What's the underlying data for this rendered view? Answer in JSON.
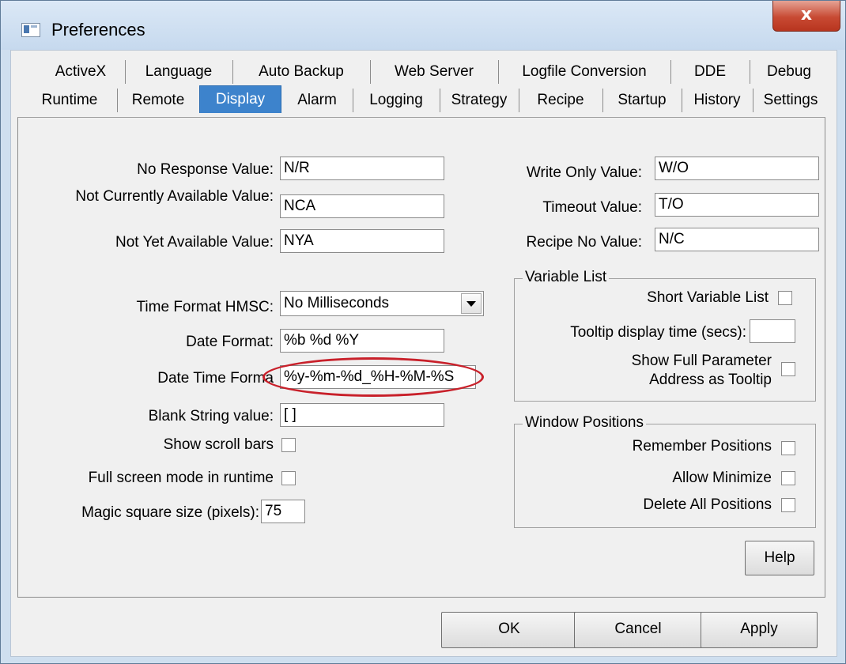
{
  "window": {
    "title": "Preferences",
    "close_glyph": "x"
  },
  "tabs": {
    "row1": [
      "ActiveX",
      "Language",
      "Auto Backup",
      "Web Server",
      "Logfile Conversion",
      "DDE",
      "Debug"
    ],
    "row2": [
      "Runtime",
      "Remote",
      "Display",
      "Alarm",
      "Logging",
      "Strategy",
      "Recipe",
      "Startup",
      "History",
      "Settings"
    ],
    "active": "Display"
  },
  "left": {
    "no_response_label": "No Response Value:",
    "no_response_value": "N/R",
    "not_currently_label": "Not Currently Available Value:",
    "not_currently_value": "NCA",
    "not_yet_label": "Not Yet Available Value:",
    "not_yet_value": "NYA",
    "time_format_label": "Time Format HMSC:",
    "time_format_value": "No Milliseconds",
    "date_format_label": "Date Format:",
    "date_format_value": "%b %d %Y",
    "date_time_label": "Date Time Forma",
    "date_time_value": "%y-%m-%d_%H-%M-%S",
    "blank_string_label": "Blank String value:",
    "blank_string_value": "[ ]",
    "show_scroll_label": "Show scroll bars",
    "full_screen_label": "Full screen mode in runtime",
    "magic_square_label": "Magic square size (pixels):",
    "magic_square_value": "75"
  },
  "right": {
    "write_only_label": "Write Only Value:",
    "write_only_value": "W/O",
    "timeout_label": "Timeout Value:",
    "timeout_value": "T/O",
    "recipe_no_label": "Recipe No Value:",
    "recipe_no_value": "N/C",
    "variable_list_legend": "Variable List",
    "short_variable_label": "Short Variable List",
    "tooltip_time_label": "Tooltip display time (secs):",
    "tooltip_time_value": "",
    "show_full_line1": "Show Full Parameter",
    "show_full_line2": "Address as Tooltip",
    "window_positions_legend": "Window Positions",
    "remember_label": "Remember Positions",
    "allow_min_label": "Allow Minimize",
    "delete_all_label": "Delete All Positions",
    "help_label": "Help"
  },
  "footer": {
    "ok_label": "OK",
    "cancel_label": "Cancel",
    "apply_label": "Apply"
  },
  "colors": {
    "active_tab": "#3d83cc",
    "highlight_oval": "#c8202a",
    "close_button": "#c84a33"
  }
}
